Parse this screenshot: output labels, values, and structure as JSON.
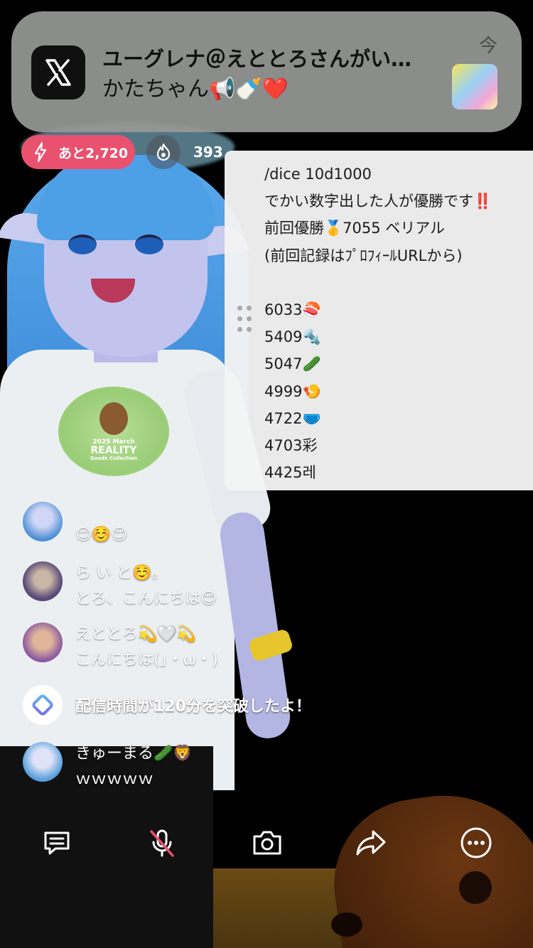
{
  "notification": {
    "app_icon": "x-logo-icon",
    "title": "ユーグレナ＠えととろさんがい…",
    "body": "かたちゃん📢🍼❤️",
    "time": "今",
    "thumbnail": "post-image-thumbnail"
  },
  "stats": {
    "remaining_label": "あと2,720",
    "remaining_icon": "lightning-icon",
    "fire_icon": "flame-icon",
    "viewer_count": "393",
    "accent_color": "#e9516f"
  },
  "pinned_message": {
    "lines": [
      "/dice 10d1000",
      "でかい数字出した人が優勝です‼️",
      "前回優勝🥇7055 ベリアル",
      "(前回記録はﾌﾟﾛﾌｨｰﾙURLから)",
      "",
      "6033🍣",
      "5409🔩",
      "5047🥒",
      "4999🍤",
      "4722🩲",
      "4703彩",
      "4425레"
    ]
  },
  "chat": {
    "messages": [
      {
        "name": "",
        "text": "😊☺️😊",
        "avatar_color": "#4d8fd6"
      },
      {
        "name": "ら い と☺️。",
        "text": "とろ、こんにちは😊",
        "avatar_color": "#5a4a78"
      },
      {
        "name": "えととろ💫🤍💫",
        "text": "こんにちは(」・ω・)",
        "avatar_color": "#8a5aa0"
      },
      {
        "name": "きゅーまる🥒🦁",
        "text": "ｗｗｗｗｗ",
        "avatar_color": "#5aa0dc"
      }
    ],
    "system": {
      "icon": "reality-logo-icon",
      "text": "配信時間が120分を突破したよ！"
    }
  },
  "toolbar": {
    "comment_icon": "comment-icon",
    "mic_icon": "mic-muted-icon",
    "camera_icon": "camera-icon",
    "share_icon": "share-icon",
    "more_icon": "more-icon"
  },
  "avatar_shirt_badge": {
    "line1": "2025 March",
    "line2": "REALITY",
    "line3": "Goods Collection"
  }
}
